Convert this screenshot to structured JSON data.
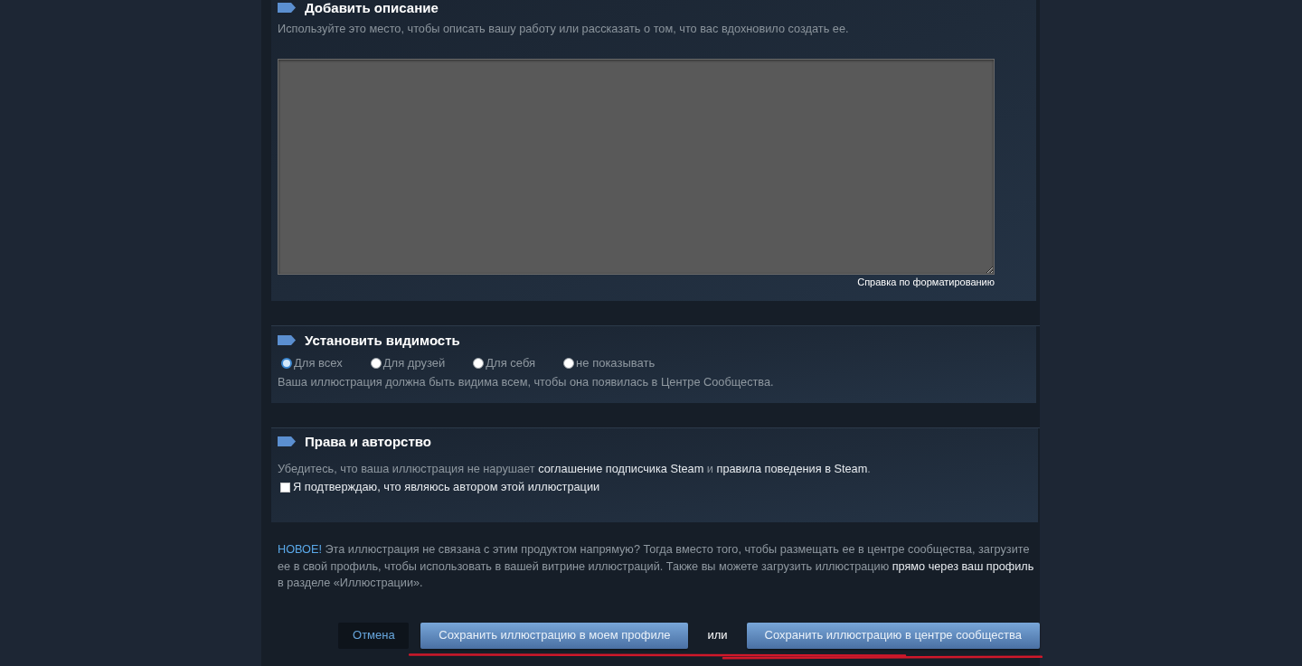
{
  "description_section": {
    "title": "Добавить описание",
    "hint": "Используйте это место, чтобы описать вашу работу или рассказать о том, что вас вдохновило создать ее.",
    "format_help_link": "Справка по форматированию"
  },
  "visibility_section": {
    "title": "Установить видимость",
    "options": [
      {
        "label": "Для всех",
        "selected": true
      },
      {
        "label": "Для друзей",
        "selected": false
      },
      {
        "label": "Для себя",
        "selected": false
      },
      {
        "label": "не показывать",
        "selected": false
      }
    ],
    "note": "Ваша иллюстрация должна быть видима всем, чтобы она появилась в Центре Сообщества."
  },
  "rights_section": {
    "title": "Права и авторство",
    "agreement": [
      {
        "kind": "text",
        "text": "Убедитесь, что ваша иллюстрация не нарушает "
      },
      {
        "kind": "link",
        "text": "соглашение подписчика Steam"
      },
      {
        "kind": "text",
        "text": " и "
      },
      {
        "kind": "link",
        "text": "правила поведения в Steam"
      },
      {
        "kind": "text",
        "text": "."
      }
    ],
    "author_checkbox": {
      "label": "Я подтверждаю, что являюсь автором этой иллюстрации",
      "checked": false
    }
  },
  "notice": [
    {
      "kind": "badge",
      "text": "НОВОЕ!"
    },
    {
      "kind": "text",
      "text": " Эта иллюстрация не связана с этим продуктом напрямую? Тогда вместо того, чтобы размещать ее в центре сообщества, загрузите ее в свой профиль, чтобы использовать в вашей витрине иллюстраций. Также вы можете загрузить иллюстрацию "
    },
    {
      "kind": "link",
      "text": "прямо через ваш профиль"
    },
    {
      "kind": "text",
      "text": " в разделе «Иллюстрации»."
    }
  ],
  "actions": [
    {
      "kind": "cancel",
      "label": "Отмена"
    },
    {
      "kind": "primary",
      "label": "Сохранить иллюстрацию в моем профиле"
    },
    {
      "kind": "separator",
      "label": "или"
    },
    {
      "kind": "primary",
      "label": "Сохранить иллюстрацию в центре сообщества"
    }
  ]
}
